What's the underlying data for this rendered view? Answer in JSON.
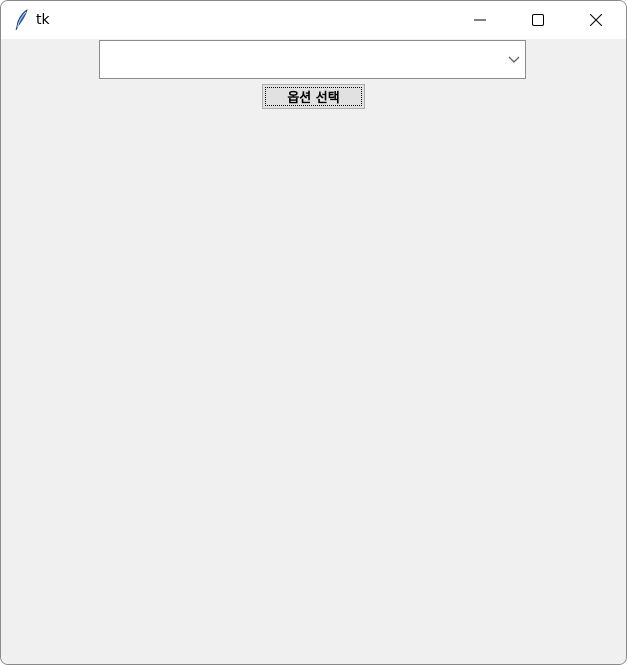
{
  "window": {
    "title": "tk"
  },
  "icons": {
    "app": "feather-icon",
    "minimize": "minimize-icon",
    "maximize": "maximize-icon",
    "close": "close-icon",
    "dropdown": "chevron-down-icon"
  },
  "combobox": {
    "value": "",
    "placeholder": ""
  },
  "button": {
    "label": "옵션 선택"
  },
  "colors": {
    "background": "#f0f0f0",
    "titlebar": "#ffffff"
  }
}
